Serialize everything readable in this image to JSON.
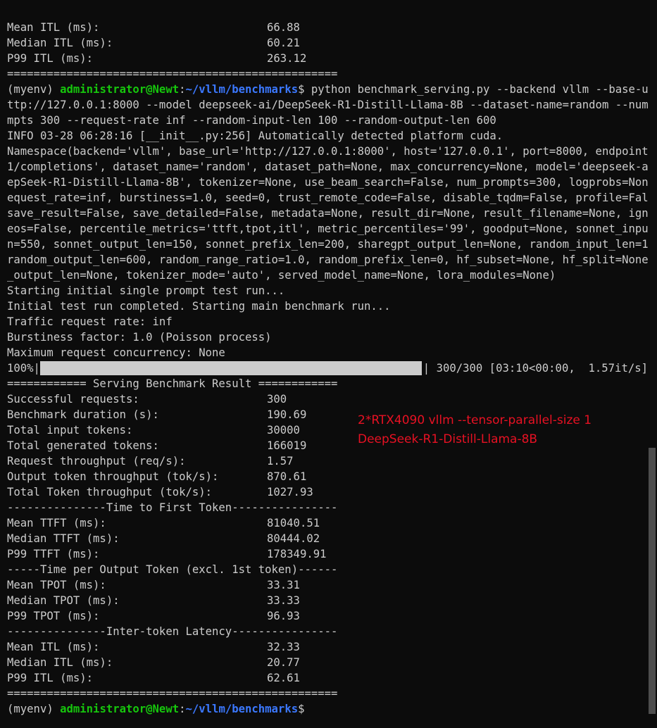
{
  "top_metrics": [
    {
      "label": "Mean ITL (ms):",
      "value": "66.88"
    },
    {
      "label": "Median ITL (ms):",
      "value": "60.21"
    },
    {
      "label": "P99 ITL (ms):",
      "value": "263.12"
    }
  ],
  "separator": "==================================================",
  "prompt": {
    "env": "(myenv) ",
    "userhost": "administrator@Newt",
    "colon": ":",
    "path": "~/vllm/benchmarks",
    "dollar": "$"
  },
  "command_lines": [
    " python benchmark_serving.py --backend vllm --base-url h",
    "ttp://127.0.0.1:8000 --model deepseek-ai/DeepSeek-R1-Distill-Llama-8B --dataset-name=random --num-pro",
    "mpts 300 --request-rate inf --random-input-len 100 --random-output-len 600"
  ],
  "output_lines": [
    "INFO 03-28 06:28:16 [__init__.py:256] Automatically detected platform cuda.",
    "Namespace(backend='vllm', base_url='http://127.0.0.1:8000', host='127.0.0.1', port=8000, endpoint='/v",
    "1/completions', dataset_name='random', dataset_path=None, max_concurrency=None, model='deepseek-ai/De",
    "epSeek-R1-Distill-Llama-8B', tokenizer=None, use_beam_search=False, num_prompts=300, logprobs=None, r",
    "equest_rate=inf, burstiness=1.0, seed=0, trust_remote_code=False, disable_tqdm=False, profile=False,",
    "save_result=False, save_detailed=False, metadata=None, result_dir=None, result_filename=None, ignore_",
    "eos=False, percentile_metrics='ttft,tpot,itl', metric_percentiles='99', goodput=None, sonnet_input_le",
    "n=550, sonnet_output_len=150, sonnet_prefix_len=200, sharegpt_output_len=None, random_input_len=100,",
    "random_output_len=600, random_range_ratio=1.0, random_prefix_len=0, hf_subset=None, hf_split=None, hf",
    "_output_len=None, tokenizer_mode='auto', served_model_name=None, lora_modules=None)",
    "Starting initial single prompt test run...",
    "Initial test run completed. Starting main benchmark run...",
    "Traffic request rate: inf",
    "Burstiness factor: 1.0 (Poisson process)",
    "Maximum request concurrency: None"
  ],
  "progress": {
    "percent_label": "100%|",
    "fraction": 1.0,
    "suffix": "| 300/300 [03:10<00:00,  1.57it/s]"
  },
  "result_header": "============ Serving Benchmark Result ============",
  "summary_metrics": [
    {
      "label": "Successful requests:",
      "value": "300"
    },
    {
      "label": "Benchmark duration (s):",
      "value": "190.69"
    },
    {
      "label": "Total input tokens:",
      "value": "30000"
    },
    {
      "label": "Total generated tokens:",
      "value": "166019"
    },
    {
      "label": "Request throughput (req/s):",
      "value": "1.57"
    },
    {
      "label": "Output token throughput (tok/s):",
      "value": "870.61"
    },
    {
      "label": "Total Token throughput (tok/s):",
      "value": "1027.93"
    }
  ],
  "ttft_header": "---------------Time to First Token----------------",
  "ttft_metrics": [
    {
      "label": "Mean TTFT (ms):",
      "value": "81040.51"
    },
    {
      "label": "Median TTFT (ms):",
      "value": "80444.02"
    },
    {
      "label": "P99 TTFT (ms):",
      "value": "178349.91"
    }
  ],
  "tpot_header": "-----Time per Output Token (excl. 1st token)------",
  "tpot_metrics": [
    {
      "label": "Mean TPOT (ms):",
      "value": "33.31"
    },
    {
      "label": "Median TPOT (ms):",
      "value": "33.33"
    },
    {
      "label": "P99 TPOT (ms):",
      "value": "96.93"
    }
  ],
  "itl_header": "---------------Inter-token Latency----------------",
  "itl_metrics": [
    {
      "label": "Mean ITL (ms):",
      "value": "32.33"
    },
    {
      "label": "Median ITL (ms):",
      "value": "20.77"
    },
    {
      "label": "P99 ITL (ms):",
      "value": "62.61"
    }
  ],
  "annotation": {
    "line1": "2*RTX4090 vllm --tensor-parallel-size 1",
    "line2": "DeepSeek-R1-Distill-Llama-8B",
    "color": "#e81123"
  },
  "colors": {
    "background": "#0c0c0c",
    "text": "#cccccc",
    "prompt_green": "#16c60c",
    "prompt_blue": "#3b78ff"
  }
}
